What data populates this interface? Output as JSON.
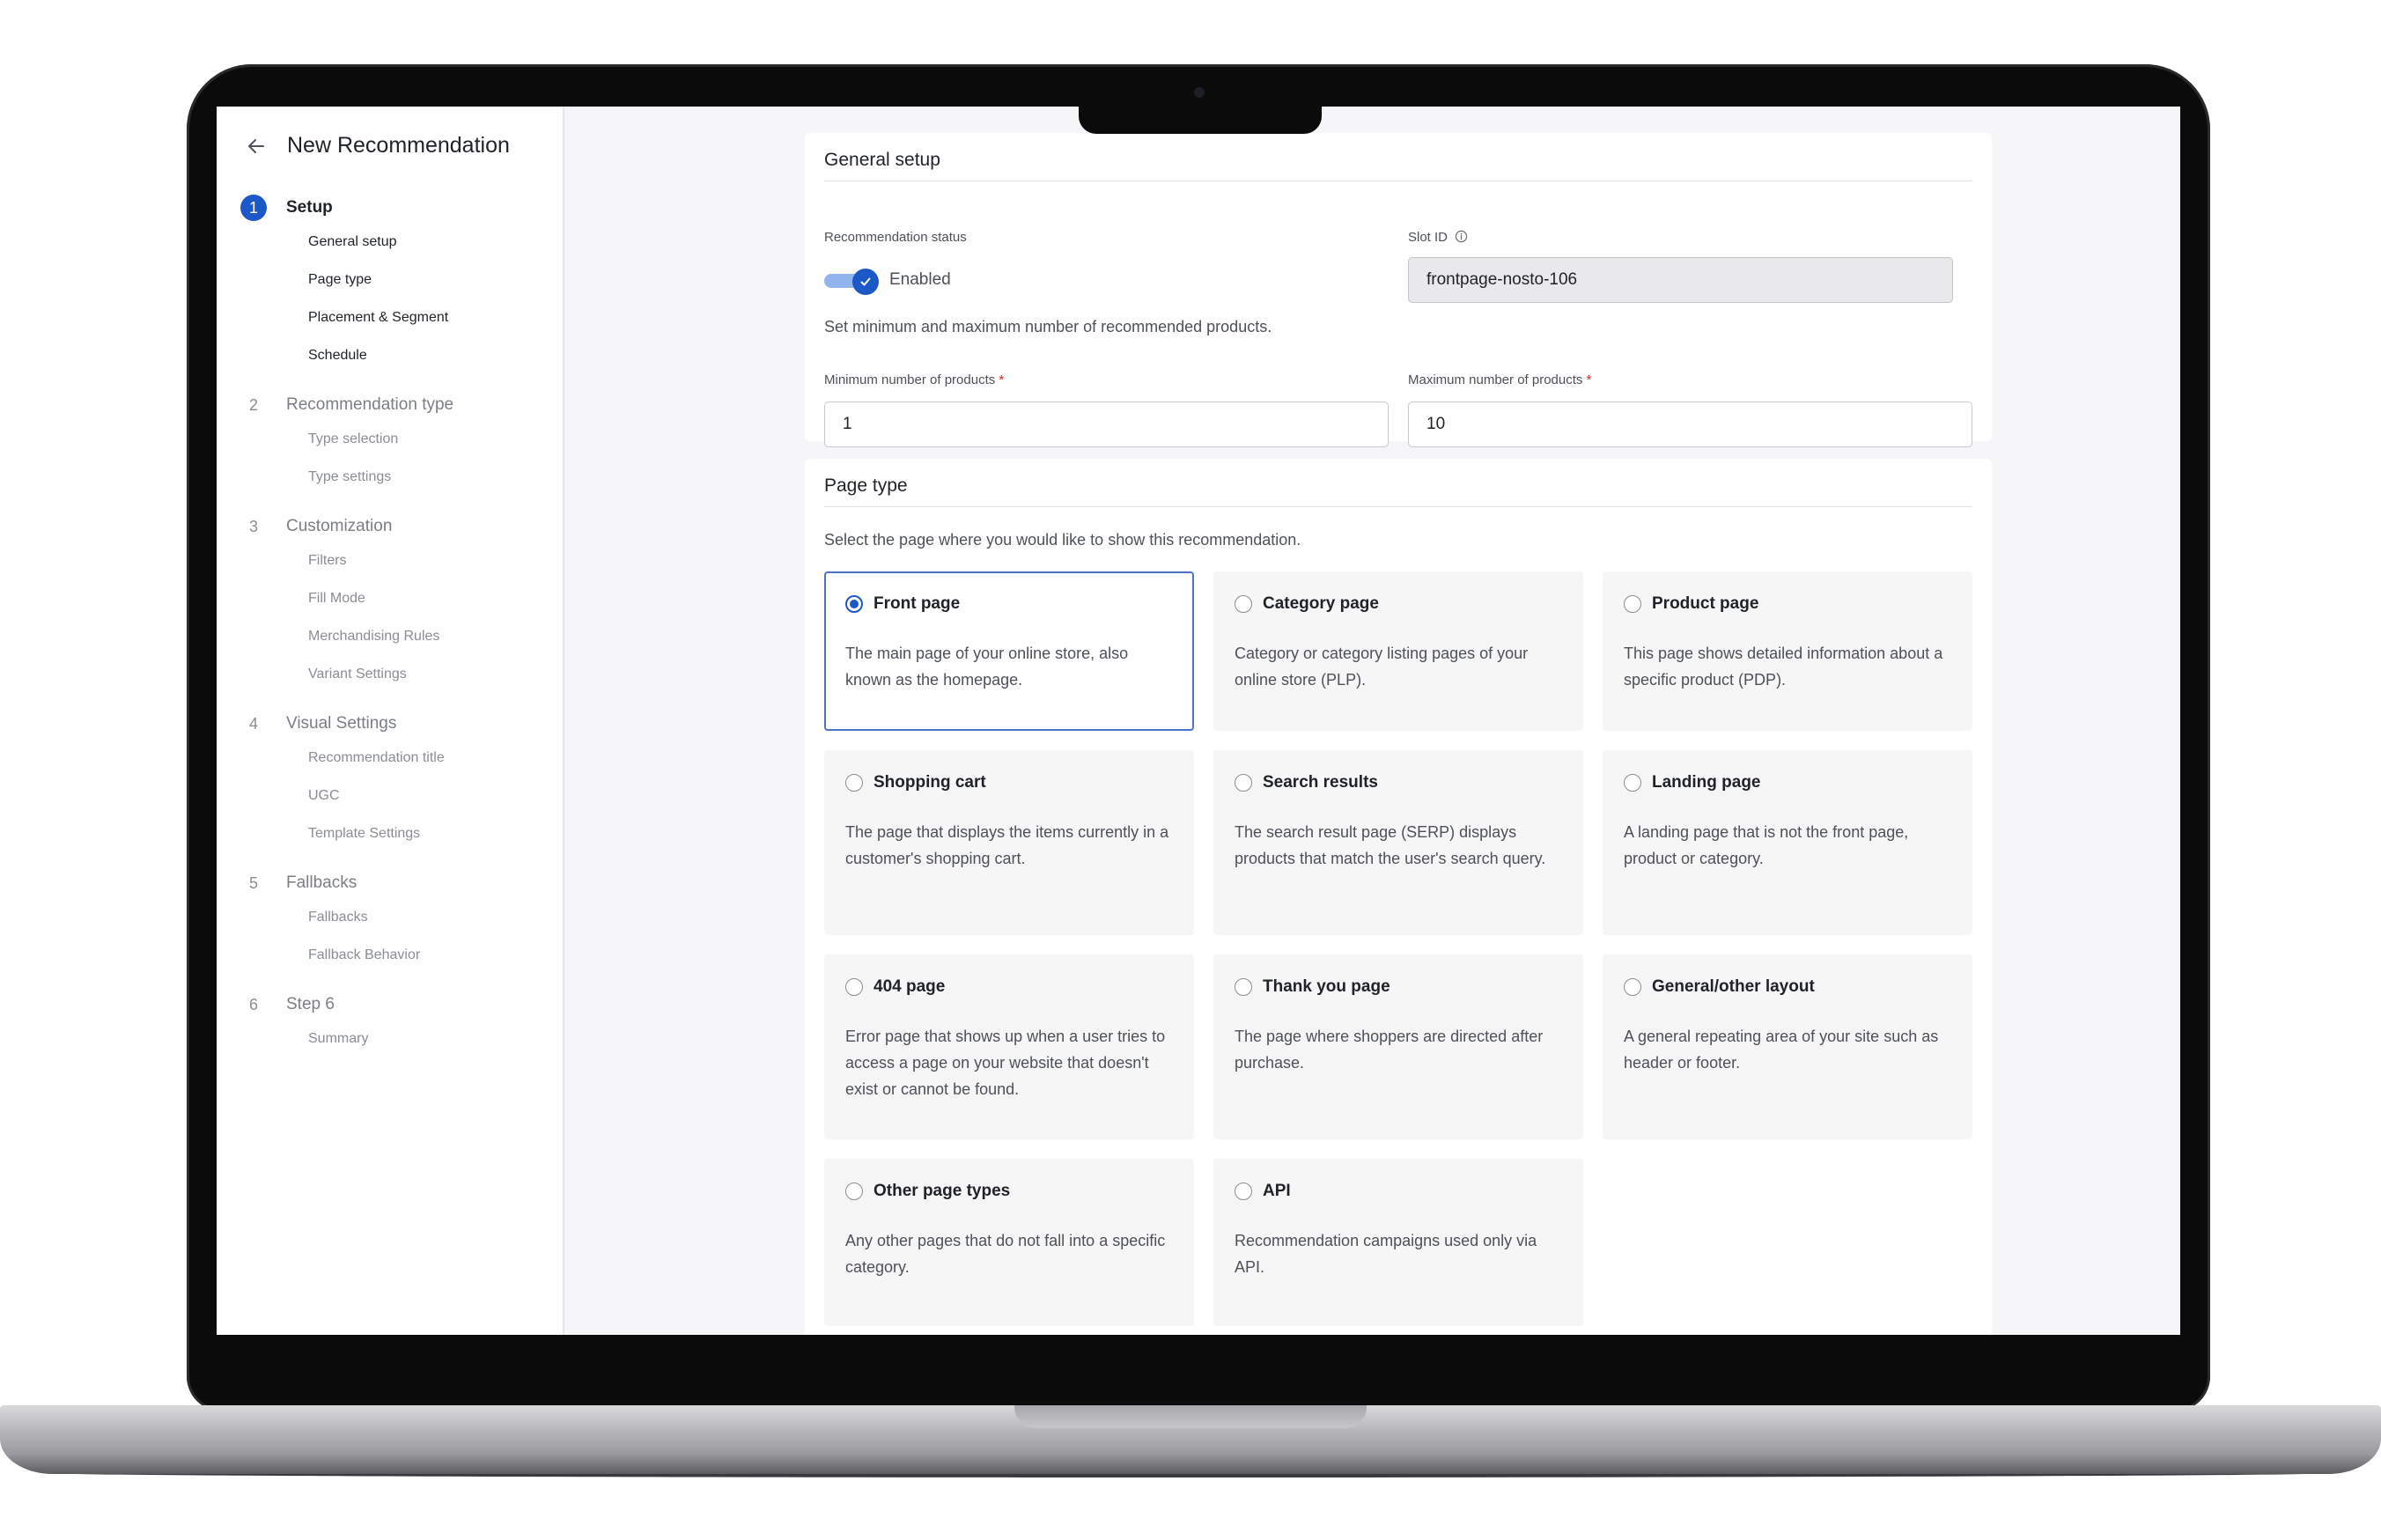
{
  "sidebar": {
    "title": "New Recommendation",
    "steps": [
      {
        "num": "1",
        "label": "Setup",
        "subs": [
          "General setup",
          "Page type",
          "Placement & Segment",
          "Schedule"
        ]
      },
      {
        "num": "2",
        "label": "Recommendation type",
        "subs": [
          "Type selection",
          "Type settings"
        ]
      },
      {
        "num": "3",
        "label": "Customization",
        "subs": [
          "Filters",
          "Fill Mode",
          "Merchandising Rules",
          "Variant Settings"
        ]
      },
      {
        "num": "4",
        "label": "Visual Settings",
        "subs": [
          "Recommendation title",
          "UGC",
          "Template Settings"
        ]
      },
      {
        "num": "5",
        "label": "Fallbacks",
        "subs": [
          "Fallbacks",
          "Fallback Behavior"
        ]
      },
      {
        "num": "6",
        "label": "Step 6",
        "subs": [
          "Summary"
        ]
      }
    ]
  },
  "general": {
    "title": "General setup",
    "status_label": "Recommendation status",
    "status_value": "Enabled",
    "slot_label": "Slot ID",
    "slot_value": "frontpage-nosto-106",
    "helper": "Set minimum and maximum number of recommended products.",
    "min_label": "Minimum number of products",
    "min_value": "1",
    "max_label": "Maximum number of products",
    "max_value": "10",
    "required_mark": "*"
  },
  "page_type": {
    "title": "Page type",
    "helper": "Select the page where you would like to show this recommendation.",
    "options": [
      {
        "title": "Front page",
        "desc": "The main page of your online store, also known as the homepage."
      },
      {
        "title": "Category page",
        "desc": "Category or category listing pages of your online store (PLP)."
      },
      {
        "title": "Product page",
        "desc": "This page shows detailed information about a specific product (PDP)."
      },
      {
        "title": "Shopping cart",
        "desc": "The page that displays the items currently in a customer's shopping cart."
      },
      {
        "title": "Search results",
        "desc": "The search result page (SERP) displays products that match the user's search query."
      },
      {
        "title": "Landing page",
        "desc": "A landing page that is not the front page, product or category."
      },
      {
        "title": "404 page",
        "desc": "Error page that shows up when a user tries to access a page on your website that doesn't exist or cannot be found."
      },
      {
        "title": "Thank you page",
        "desc": "The page where shoppers are directed after purchase."
      },
      {
        "title": "General/other layout",
        "desc": "A general repeating area of your site such as header or footer."
      },
      {
        "title": "Other page types",
        "desc": "Any other pages that do not fall into a specific category."
      },
      {
        "title": "API",
        "desc": "Recommendation campaigns used only via API."
      }
    ]
  },
  "colors": {
    "accent": "#1c58c7",
    "selected_border": "#4b74c9"
  }
}
